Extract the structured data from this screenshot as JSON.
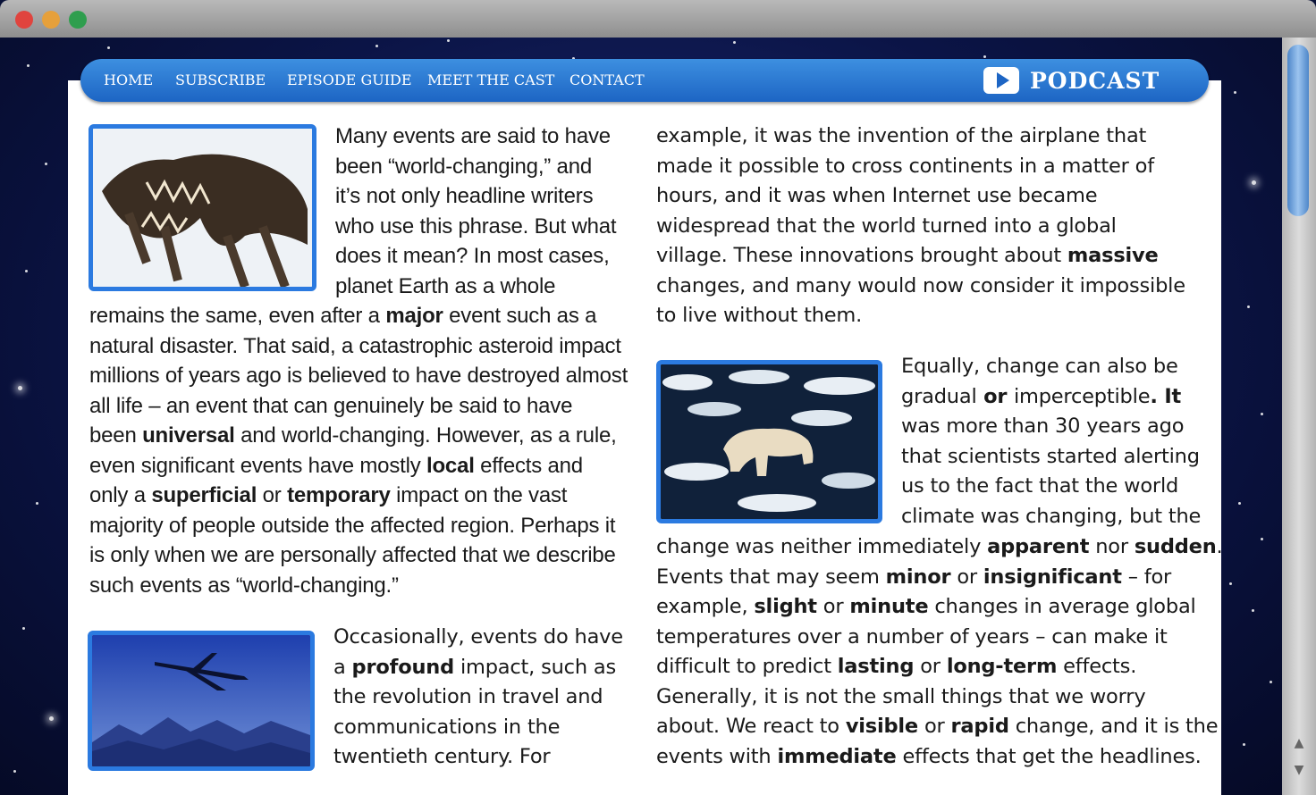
{
  "nav": {
    "items": [
      "HOME",
      "SUBSCRIBE",
      "EPISODE GUIDE",
      "MEET THE CAST",
      "CONTACT"
    ],
    "podcast_label": "PODCAST"
  },
  "images": {
    "dinosaur": "dinosaur-skeleton",
    "airplane": "airplane-silhouette",
    "polar_bear": "polar-bear-on-ice"
  },
  "article": {
    "col1_intro_lines": [
      "Many events are said to have",
      "been “world-changing,” and",
      "it’s not only headline writers",
      "who use this phrase. But what",
      "does it mean? In most cases,",
      "planet Earth as a whole"
    ],
    "col1_full_lines": [
      [
        "remains the same, even after a ",
        "major",
        " event such as a"
      ],
      [
        "natural disaster. That said, a catastrophic asteroid impact"
      ],
      [
        "millions of years ago is believed to have destroyed almost"
      ],
      [
        "all life – an event that can genuinely be said to have"
      ],
      [
        "been ",
        "universal",
        " and world-changing. However, as a rule,"
      ],
      [
        "even significant events have mostly ",
        "local",
        " effects and"
      ],
      [
        "only a ",
        "superficial",
        " or ",
        "temporary",
        " impact on the vast"
      ],
      [
        "majority of people outside the affected region. Perhaps it"
      ],
      [
        "is only when we are personally affected that we describe"
      ],
      [
        "such events as “world-changing.”"
      ]
    ],
    "col1_plane_lines": [
      [
        "Occasionally, events do have"
      ],
      [
        "a ",
        "profound",
        " impact, such as"
      ],
      [
        "the revolution in travel and"
      ],
      [
        "communications in the"
      ],
      [
        "twentieth century. For"
      ]
    ],
    "col2_top_lines": [
      [
        "example, it was the invention of the airplane that"
      ],
      [
        "made it possible to cross continents in a matter of"
      ],
      [
        "hours, and it was when Internet use became"
      ],
      [
        "widespread that the world turned into a global"
      ],
      [
        "village. These innovations brought about ",
        "massive"
      ],
      [
        "changes, and many would now consider it impossible"
      ],
      [
        "to live without them."
      ]
    ],
    "col2_bear_lines": [
      [
        "Equally, change can also be"
      ],
      [
        "gradual",
        " or ",
        "imperceptible",
        ". It"
      ],
      [
        "was more than 30 years ago"
      ],
      [
        "that scientists started alerting"
      ],
      [
        "us to the fact that the world"
      ],
      [
        "climate was changing, but the"
      ]
    ],
    "col2_full_lines": [
      [
        "change was neither immediately ",
        "apparent",
        " nor ",
        "sudden",
        "."
      ],
      [
        "Events that may seem ",
        "minor",
        " or ",
        "insignificant",
        " – for"
      ],
      [
        "example, ",
        "slight",
        " or ",
        "minute",
        " changes in average global"
      ],
      [
        "temperatures over a number of years – can make it"
      ],
      [
        "difficult to predict ",
        "lasting",
        " or ",
        "long-term",
        " effects."
      ],
      [
        "Generally, it is not the small things that we worry"
      ],
      [
        "about. We react to ",
        "visible",
        " or ",
        "rapid",
        " change, and it is the"
      ],
      [
        "events with ",
        "immediate",
        " effects that get the headlines."
      ]
    ]
  }
}
